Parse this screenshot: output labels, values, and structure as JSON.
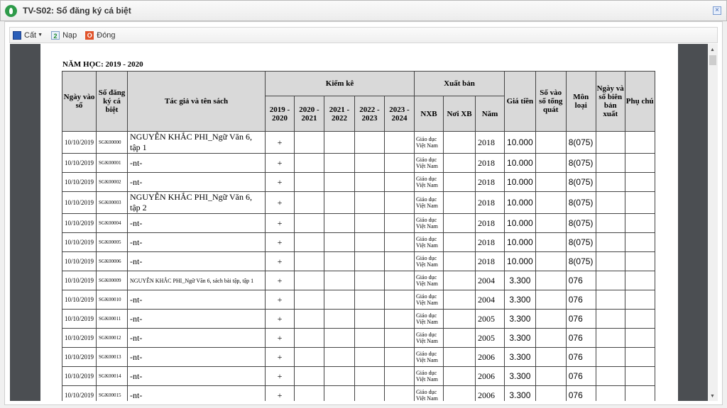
{
  "window": {
    "title": "TV-S02: Sổ đăng ký cá biệt",
    "close": "×"
  },
  "toolbar": {
    "save": "Cất",
    "reload": "Nạp",
    "close": "Đóng"
  },
  "report": {
    "year_label": "NĂM HỌC: 2019 - 2020",
    "headers": {
      "date": "Ngày vào sổ",
      "reg": "Số đăng ký cá biệt",
      "title": "Tác giả và tên sách",
      "inventory": "Kiểm kê",
      "inv_years": [
        "2019 - 2020",
        "2020 - 2021",
        "2021 - 2022",
        "2022 - 2023",
        "2023 - 2024"
      ],
      "publish": "Xuất bản",
      "publisher": "NXB",
      "place": "Nơi XB",
      "year": "Năm",
      "price": "Giá tiền",
      "general": "Số vào sổ tổng quát",
      "subject": "Môn loại",
      "export": "Ngày và số biên bản xuất",
      "note": "Phụ chú"
    },
    "rows": [
      {
        "date": "10/10/2019",
        "reg": "SGK00000",
        "title": "NGUYỄN KHẮC PHI_Ngữ Văn 6, tập 1",
        "inv": "+",
        "nxb": "Giáo dục Việt Nam",
        "year": "2018",
        "price": "10.000",
        "subject": "8(075)"
      },
      {
        "date": "10/10/2019",
        "reg": "SGK00001",
        "title": "-nt-",
        "inv": "+",
        "nxb": "Giáo dục Việt Nam",
        "year": "2018",
        "price": "10.000",
        "subject": "8(075)"
      },
      {
        "date": "10/10/2019",
        "reg": "SGK00002",
        "title": "-nt-",
        "inv": "+",
        "nxb": "Giáo dục Việt Nam",
        "year": "2018",
        "price": "10.000",
        "subject": "8(075)"
      },
      {
        "date": "10/10/2019",
        "reg": "SGK00003",
        "title": "NGUYỄN KHẮC PHI_Ngữ Văn 6, tập 2",
        "inv": "+",
        "nxb": "Giáo dục Việt Nam",
        "year": "2018",
        "price": "10.000",
        "subject": "8(075)"
      },
      {
        "date": "10/10/2019",
        "reg": "SGK00004",
        "title": "-nt-",
        "inv": "+",
        "nxb": "Giáo dục Việt Nam",
        "year": "2018",
        "price": "10.000",
        "subject": "8(075)"
      },
      {
        "date": "10/10/2019",
        "reg": "SGK00005",
        "title": "-nt-",
        "inv": "+",
        "nxb": "Giáo dục Việt Nam",
        "year": "2018",
        "price": "10.000",
        "subject": "8(075)"
      },
      {
        "date": "10/10/2019",
        "reg": "SGK00006",
        "title": "-nt-",
        "inv": "+",
        "nxb": "Giáo dục Việt Nam",
        "year": "2018",
        "price": "10.000",
        "subject": "8(075)"
      },
      {
        "date": "10/10/2019",
        "reg": "SGK00009",
        "title": "NGUYỄN KHẮC PHI_Ngữ Văn 6, sách bài tập, tập 1",
        "inv": "+",
        "nxb": "Giáo dục Việt Nam",
        "year": "2004",
        "price": "3.300",
        "subject": "076"
      },
      {
        "date": "10/10/2019",
        "reg": "SGK00010",
        "title": "-nt-",
        "inv": "+",
        "nxb": "Giáo dục Việt Nam",
        "year": "2004",
        "price": "3.300",
        "subject": "076"
      },
      {
        "date": "10/10/2019",
        "reg": "SGK00011",
        "title": "-nt-",
        "inv": "+",
        "nxb": "Giáo dục Việt Nam",
        "year": "2005",
        "price": "3.300",
        "subject": "076"
      },
      {
        "date": "10/10/2019",
        "reg": "SGK00012",
        "title": "-nt-",
        "inv": "+",
        "nxb": "Giáo dục Việt Nam",
        "year": "2005",
        "price": "3.300",
        "subject": "076"
      },
      {
        "date": "10/10/2019",
        "reg": "SGK00013",
        "title": "-nt-",
        "inv": "+",
        "nxb": "Giáo dục Việt Nam",
        "year": "2006",
        "price": "3.300",
        "subject": "076"
      },
      {
        "date": "10/10/2019",
        "reg": "SGK00014",
        "title": "-nt-",
        "inv": "+",
        "nxb": "Giáo dục Việt Nam",
        "year": "2006",
        "price": "3.300",
        "subject": "076"
      },
      {
        "date": "10/10/2019",
        "reg": "SGK00015",
        "title": "-nt-",
        "inv": "+",
        "nxb": "Giáo dục Việt Nam",
        "year": "2006",
        "price": "3.300",
        "subject": "076"
      }
    ]
  }
}
